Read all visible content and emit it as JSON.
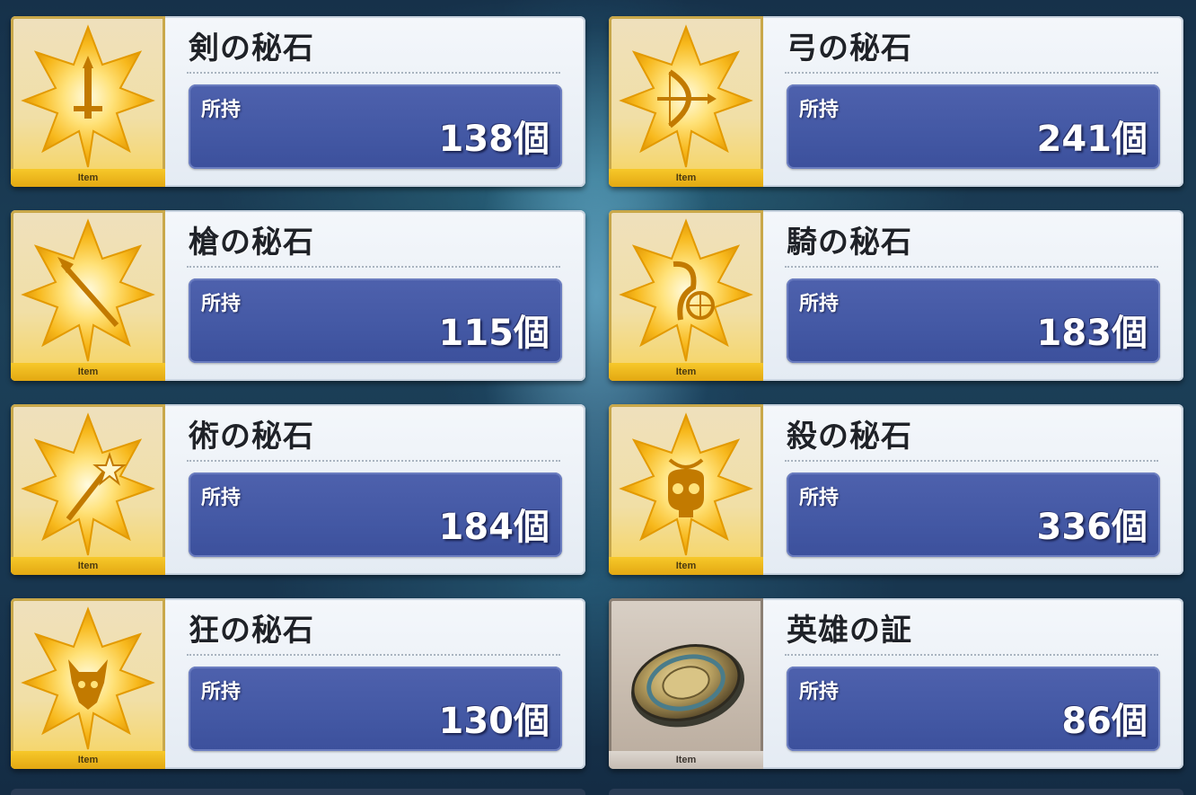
{
  "items": [
    {
      "name": "剣の秘石",
      "qty_label": "所持",
      "qty": "138個",
      "tag": "Item",
      "icon": "saber-gem-icon"
    },
    {
      "name": "弓の秘石",
      "qty_label": "所持",
      "qty": "241個",
      "tag": "Item",
      "icon": "archer-gem-icon"
    },
    {
      "name": "槍の秘石",
      "qty_label": "所持",
      "qty": "115個",
      "tag": "Item",
      "icon": "lancer-gem-icon"
    },
    {
      "name": "騎の秘石",
      "qty_label": "所持",
      "qty": "183個",
      "tag": "Item",
      "icon": "rider-gem-icon"
    },
    {
      "name": "術の秘石",
      "qty_label": "所持",
      "qty": "184個",
      "tag": "Item",
      "icon": "caster-gem-icon"
    },
    {
      "name": "殺の秘石",
      "qty_label": "所持",
      "qty": "336個",
      "tag": "Item",
      "icon": "assassin-gem-icon"
    },
    {
      "name": "狂の秘石",
      "qty_label": "所持",
      "qty": "130個",
      "tag": "Item",
      "icon": "berserker-gem-icon"
    },
    {
      "name": "英雄の証",
      "qty_label": "所持",
      "qty": "86個",
      "tag": "Item",
      "icon": "heroic-proof-icon"
    }
  ],
  "colors": {
    "gem_gold": "#f5b81a",
    "panel_blue": "#4a5ea8",
    "card_bg": "#eef2f7",
    "item_tag": "#f2bf25"
  }
}
